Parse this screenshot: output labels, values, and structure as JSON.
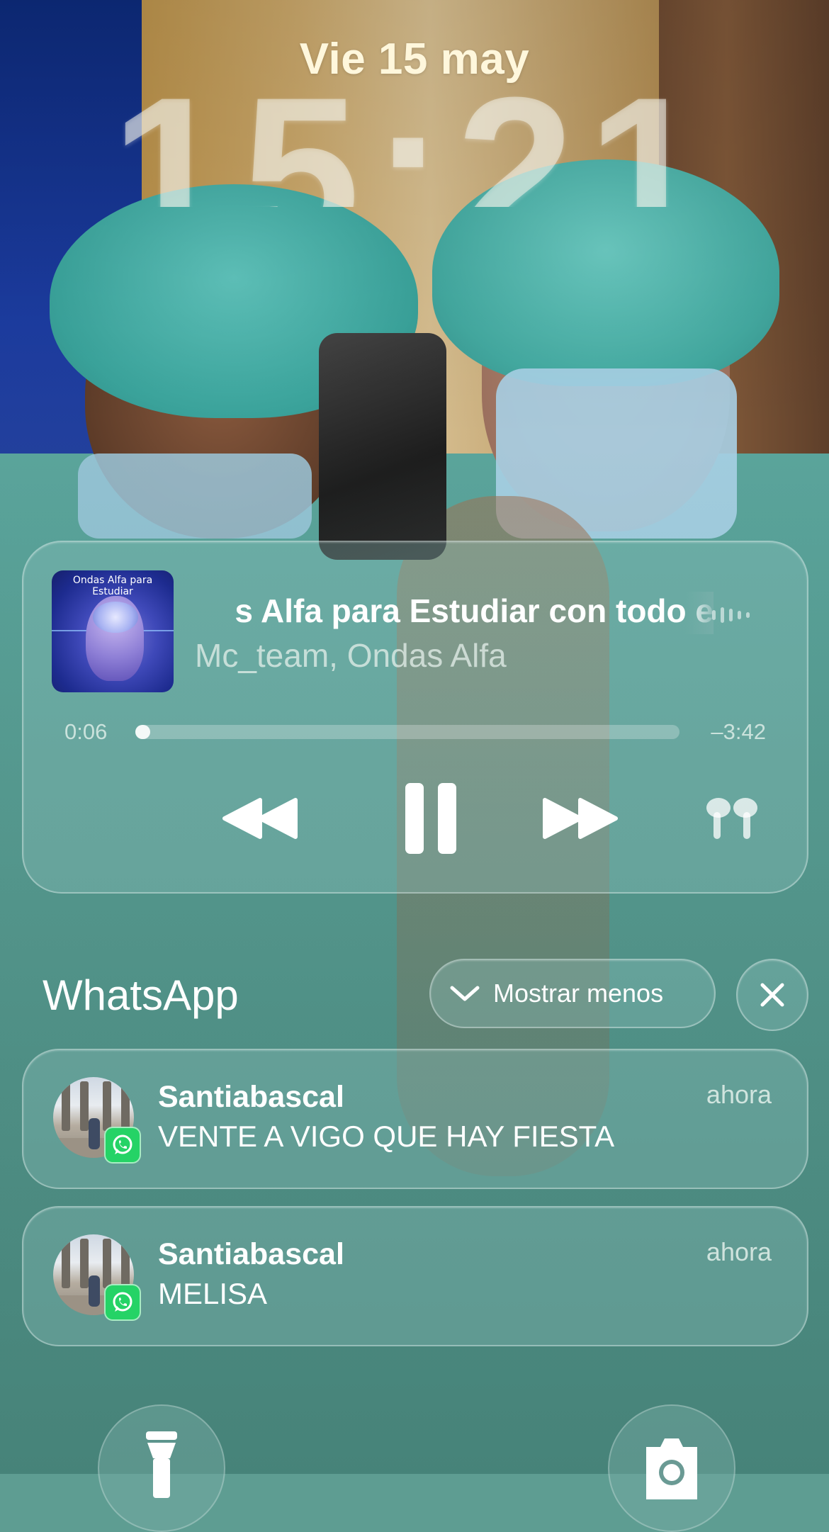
{
  "lock_screen": {
    "date": "Vie 15 may",
    "time": "15:21"
  },
  "now_playing": {
    "artwork_text": "Ondas Alfa para Estudiar",
    "title": "s Alfa para Estudiar con todo e",
    "artist": "Mc_team, Ondas Alfa",
    "elapsed": "0:06",
    "remaining": "–3:42",
    "progress_fraction": 0.027,
    "controls": [
      "rewind-icon",
      "pause-icon",
      "fast-forward-icon",
      "airpods-icon"
    ]
  },
  "notifications": {
    "app_name": "WhatsApp",
    "show_less_label": "Mostrar menos",
    "items": [
      {
        "sender": "Santiabascal",
        "message": "VENTE A VIGO QUE HAY FIESTA",
        "time": "ahora"
      },
      {
        "sender": "Santiabascal",
        "message": "MELISA",
        "time": "ahora"
      }
    ]
  },
  "quick_actions": [
    "flashlight-icon",
    "camera-icon"
  ],
  "colors": {
    "whatsapp_green": "#25d366",
    "date_text": "#fff7dc"
  }
}
